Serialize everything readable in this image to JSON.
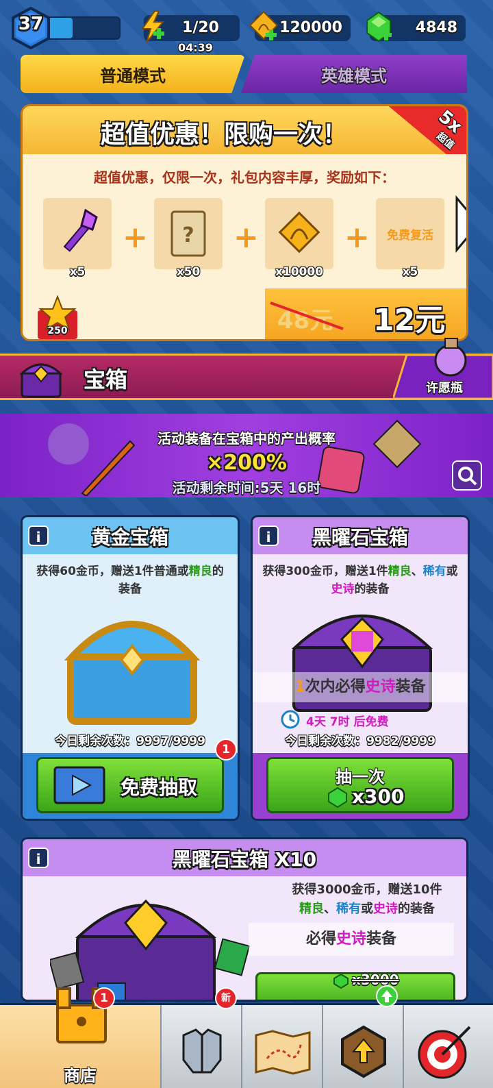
{
  "top": {
    "level": "37",
    "xp_fill_fraction": 0.35,
    "energy": "1/20",
    "timer": "04:39",
    "bows": "120000",
    "gems": "4848"
  },
  "modes": {
    "normal": "普通模式",
    "hero": "英雄模式"
  },
  "offer": {
    "title": "超值优惠！限购一次！",
    "ribbon_top": "5x",
    "ribbon_sub": "超值",
    "desc": "超值优惠，仅限一次，礼包内容丰厚，奖励如下：",
    "items": [
      {
        "icon": "purple-key-icon",
        "qty": "x5"
      },
      {
        "icon": "mystery-scroll-icon",
        "qty": "x50"
      },
      {
        "icon": "bow-token-icon",
        "qty": "x10000"
      },
      {
        "icon": "free-revive-text",
        "label": "免费复活",
        "qty": "x5"
      }
    ],
    "old_price": "48元",
    "new_price": "12元",
    "star_points": "250"
  },
  "chest_section": {
    "title": "宝箱",
    "wish_bottle": "许愿瓶"
  },
  "event": {
    "line1": "活动装备在宝箱中的产出概率",
    "line2": "×200%",
    "line3": "活动剩余时间:5天 16时"
  },
  "gold_chest": {
    "title": "黄金宝箱",
    "desc_a": "获得60金币，赠送1件普通或",
    "desc_green": "精良",
    "desc_b": "的装备",
    "remaining": "今日剩余次数：9997/9999",
    "button": "免费抽取",
    "badge": "1"
  },
  "obsidian_chest": {
    "title": "黑曜石宝箱",
    "desc_a": "获得300金币，赠送1件",
    "desc_green": "精良",
    "desc_sep1": "、",
    "desc_blue": "稀有",
    "desc_or": "或",
    "desc_pink": "史诗",
    "desc_b": "的装备",
    "must_num": "1",
    "must_a": "次内必得",
    "must_pink": "史诗",
    "must_b": "装备",
    "free_timer": "4天 7时 后免费",
    "remaining": "今日剩余次数：9982/9999",
    "button": "抽一次",
    "cost": "x300"
  },
  "obsidian_x10": {
    "title": "黑曜石宝箱 X10",
    "desc_a": "获得3000金币，赠送10件",
    "desc_green": "精良",
    "desc_sep1": "、",
    "desc_blue": "稀有",
    "desc_or": "或",
    "desc_pink": "史诗",
    "desc_b": "的装备",
    "must_a": "必得",
    "must_pink": "史诗",
    "must_b": "装备",
    "old_cost": "x3000"
  },
  "nav": {
    "shop": "商店",
    "shop_badge": "1",
    "equip_badge": "新"
  },
  "colors": {
    "accent_yellow": "#f6b63a",
    "accent_purple": "#7b22c7",
    "green_button": "#3aa51a",
    "epic_pink": "#d21ac0"
  }
}
